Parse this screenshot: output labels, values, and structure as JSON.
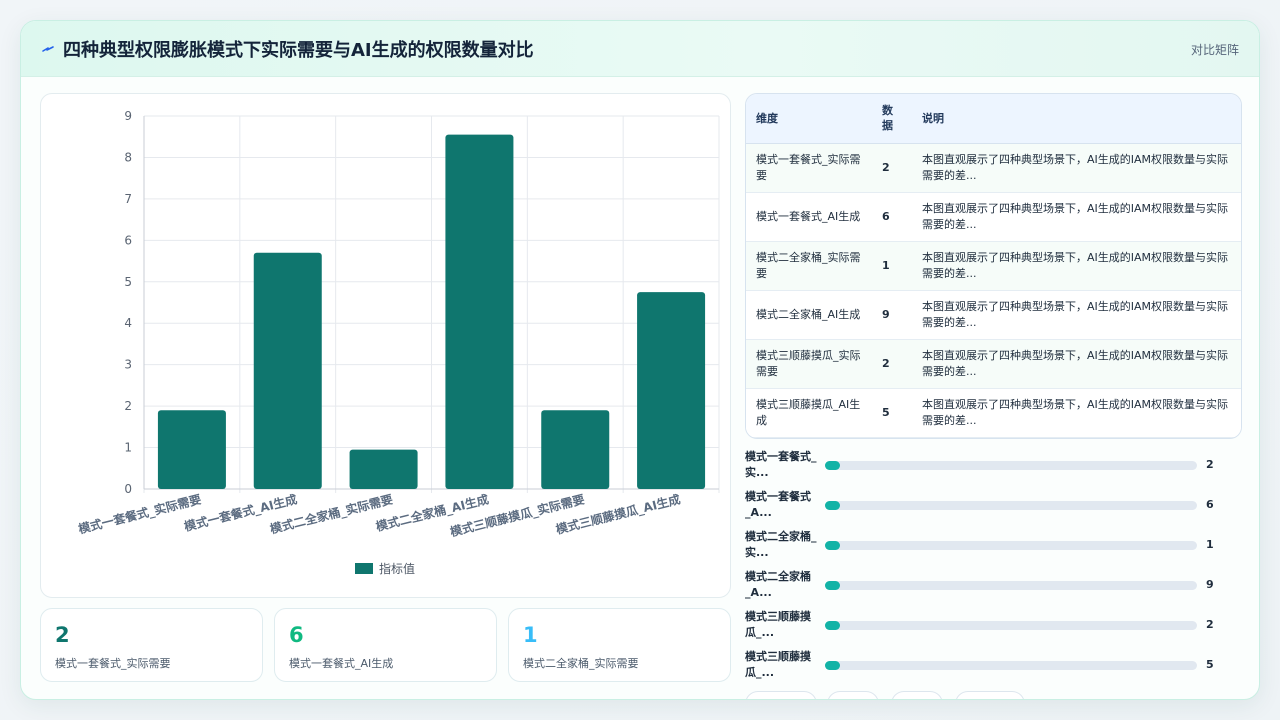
{
  "header": {
    "title": "四种典型权限膨胀模式下实际需要与AI生成的权限数量对比",
    "right_label": "对比矩阵"
  },
  "colors": {
    "bar": "#0f766e",
    "kpi1": "#0f766e",
    "kpi2": "#10b981",
    "kpi3": "#38bdf8",
    "progress": "#12b3a6"
  },
  "chart_data": {
    "type": "bar",
    "categories": [
      "模式一套餐式_实际需要",
      "模式一套餐式_AI生成",
      "模式二全家桶_实际需要",
      "模式二全家桶_AI生成",
      "模式三顺藤摸瓜_实际需要",
      "模式三顺藤摸瓜_AI生成"
    ],
    "series": [
      {
        "name": "指标值",
        "values": [
          1.9,
          5.7,
          0.95,
          8.55,
          1.9,
          4.75
        ]
      }
    ],
    "ylim": [
      0,
      9
    ],
    "yticks": [
      0,
      1,
      2,
      3,
      4,
      5,
      6,
      7,
      8,
      9
    ],
    "grid": true,
    "legend": "bottom"
  },
  "kpis": [
    {
      "value": "2",
      "label": "模式一套餐式_实际需要"
    },
    {
      "value": "6",
      "label": "模式一套餐式_AI生成"
    },
    {
      "value": "1",
      "label": "模式二全家桶_实际需要"
    }
  ],
  "table": {
    "headers": [
      "维度",
      "数据",
      "说明"
    ],
    "rows": [
      {
        "dim": "模式一套餐式_实际需要",
        "val": "2",
        "desc": "本图直观展示了四种典型场景下，AI生成的IAM权限数量与实际需要的差..."
      },
      {
        "dim": "模式一套餐式_AI生成",
        "val": "6",
        "desc": "本图直观展示了四种典型场景下，AI生成的IAM权限数量与实际需要的差..."
      },
      {
        "dim": "模式二全家桶_实际需要",
        "val": "1",
        "desc": "本图直观展示了四种典型场景下，AI生成的IAM权限数量与实际需要的差..."
      },
      {
        "dim": "模式二全家桶_AI生成",
        "val": "9",
        "desc": "本图直观展示了四种典型场景下，AI生成的IAM权限数量与实际需要的差..."
      },
      {
        "dim": "模式三顺藤摸瓜_实际需要",
        "val": "2",
        "desc": "本图直观展示了四种典型场景下，AI生成的IAM权限数量与实际需要的差..."
      },
      {
        "dim": "模式三顺藤摸瓜_AI生成",
        "val": "5",
        "desc": "本图直观展示了四种典型场景下，AI生成的IAM权限数量与实际需要的差..."
      }
    ]
  },
  "progress": [
    {
      "label": "模式一套餐式_实...",
      "value": "2",
      "fraction": 0.04
    },
    {
      "label": "模式一套餐式_A...",
      "value": "6",
      "fraction": 0.04
    },
    {
      "label": "模式二全家桶_实...",
      "value": "1",
      "fraction": 0.04
    },
    {
      "label": "模式二全家桶_A...",
      "value": "9",
      "fraction": 0.04
    },
    {
      "label": "模式三顺藤摸瓜_...",
      "value": "2",
      "fraction": 0.04
    },
    {
      "label": "模式三顺藤摸瓜_...",
      "value": "5",
      "fraction": 0.04
    }
  ]
}
